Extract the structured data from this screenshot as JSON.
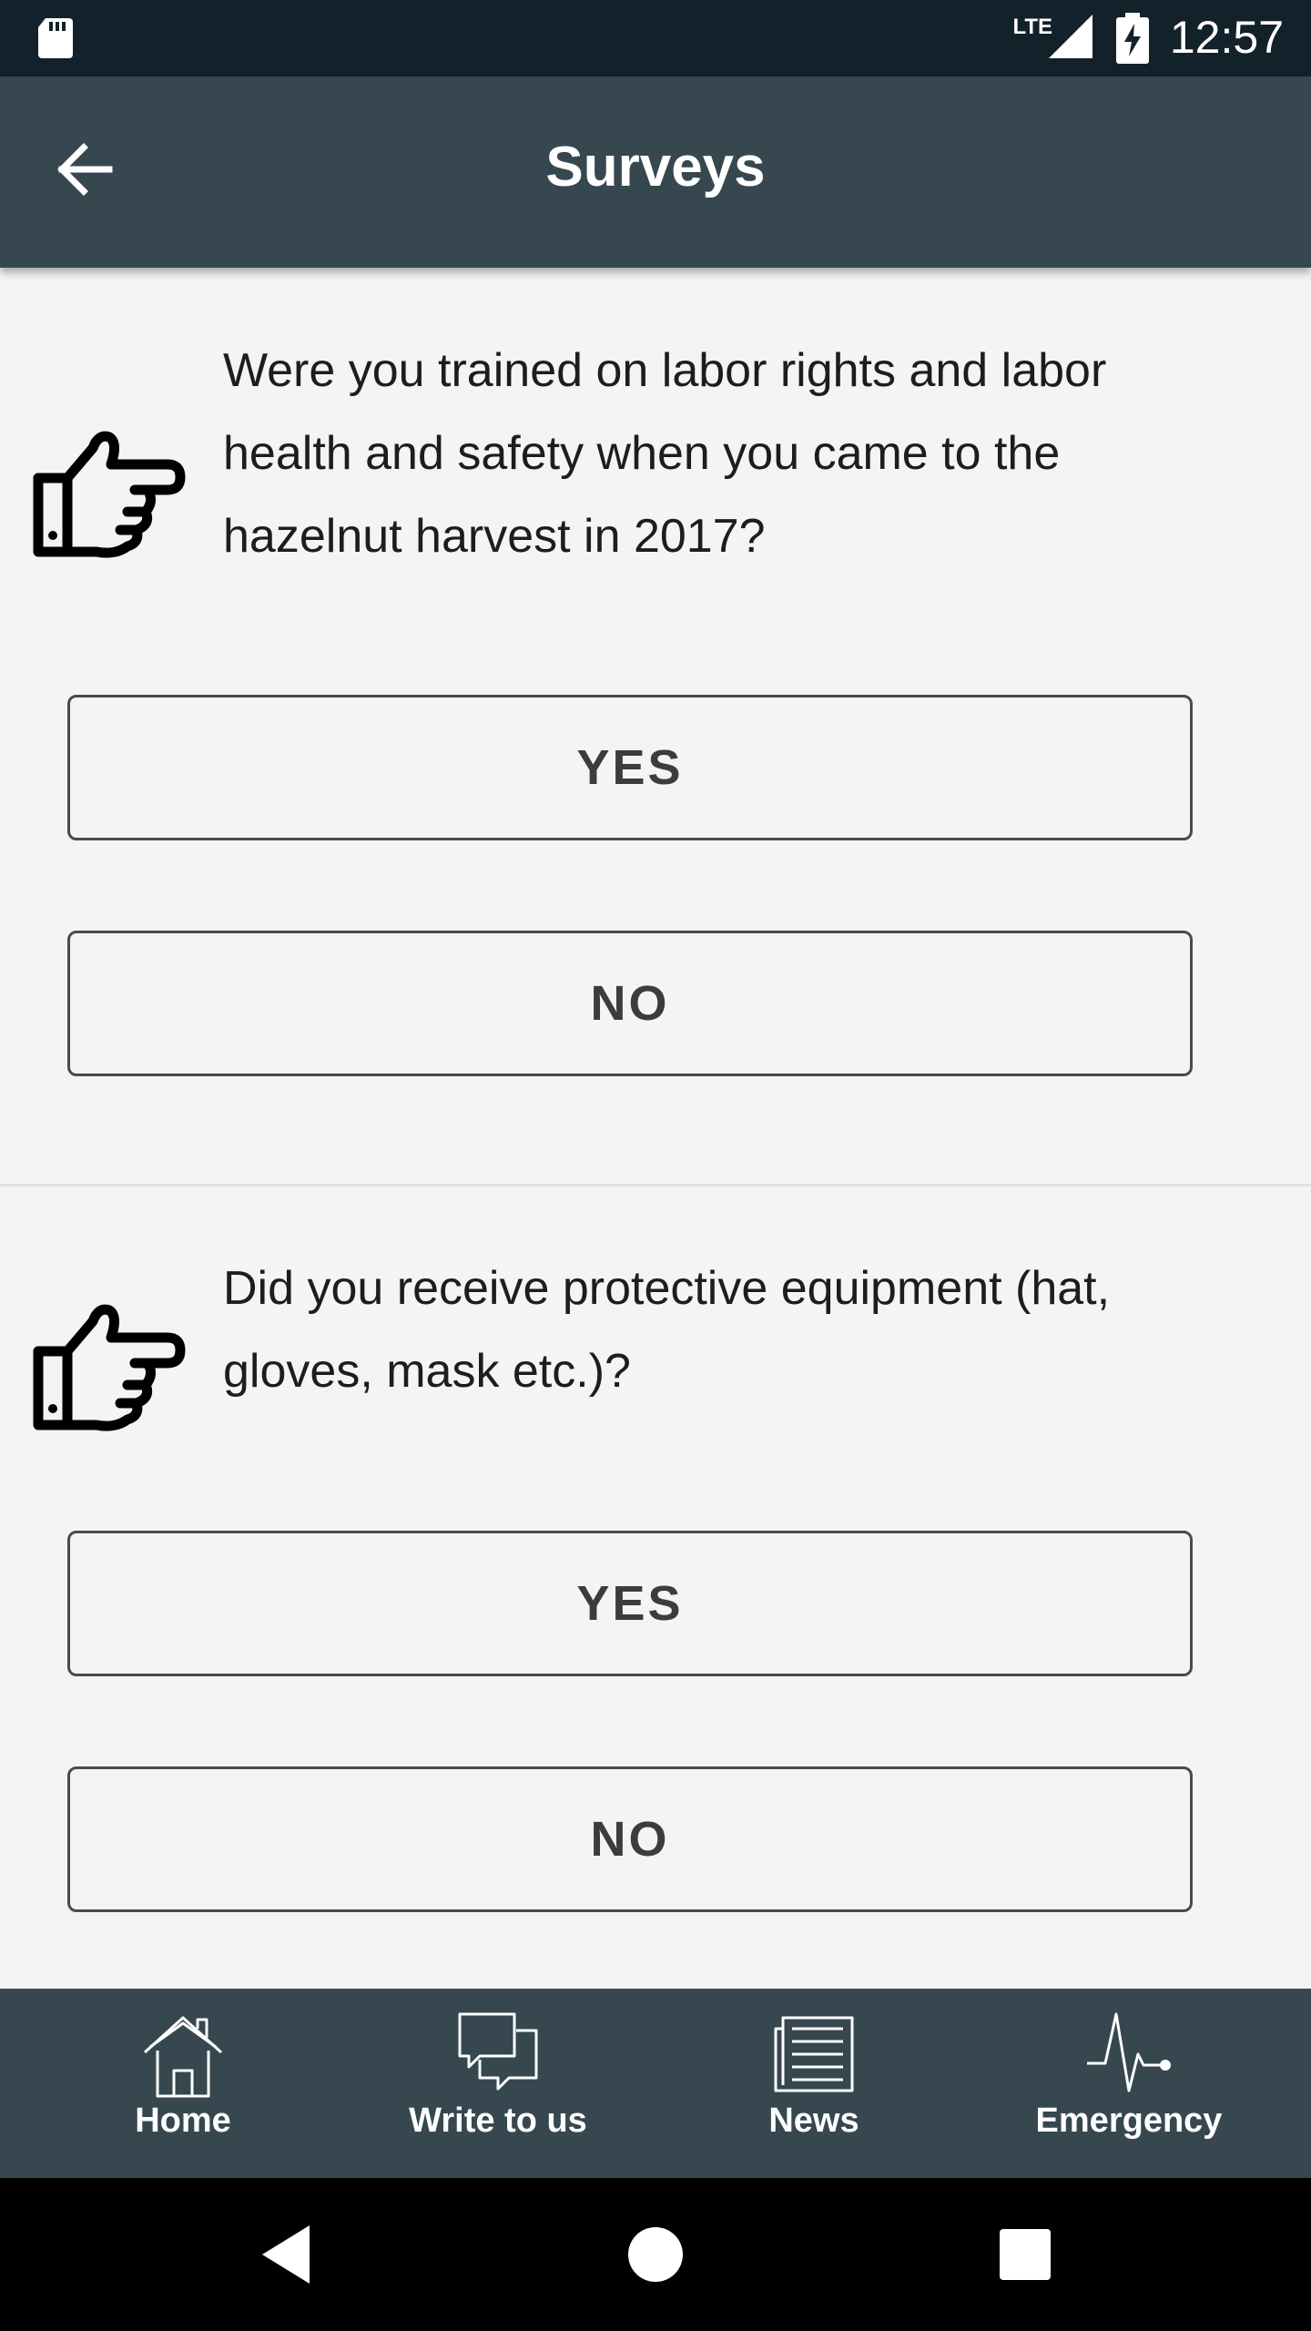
{
  "status_bar": {
    "time": "12:57",
    "network": "LTE"
  },
  "app_bar": {
    "title": "Surveys"
  },
  "questions": [
    {
      "text": "Were you trained on labor rights and labor health and safety when you came to the hazelnut harvest in 2017?",
      "yes_label": "YES",
      "no_label": "NO"
    },
    {
      "text": "Did you receive protective equipment (hat, gloves, mask etc.)?",
      "yes_label": "YES",
      "no_label": "NO"
    }
  ],
  "bottom_nav": [
    {
      "label": "Home",
      "icon": "home-icon"
    },
    {
      "label": "Write to us",
      "icon": "chat-icon"
    },
    {
      "label": "News",
      "icon": "news-icon"
    },
    {
      "label": "Emergency",
      "icon": "pulse-icon"
    }
  ],
  "colors": {
    "status_bar": "#13212a",
    "app_bar": "#36474f",
    "background": "#f4f4f4",
    "system_nav": "#000000"
  }
}
